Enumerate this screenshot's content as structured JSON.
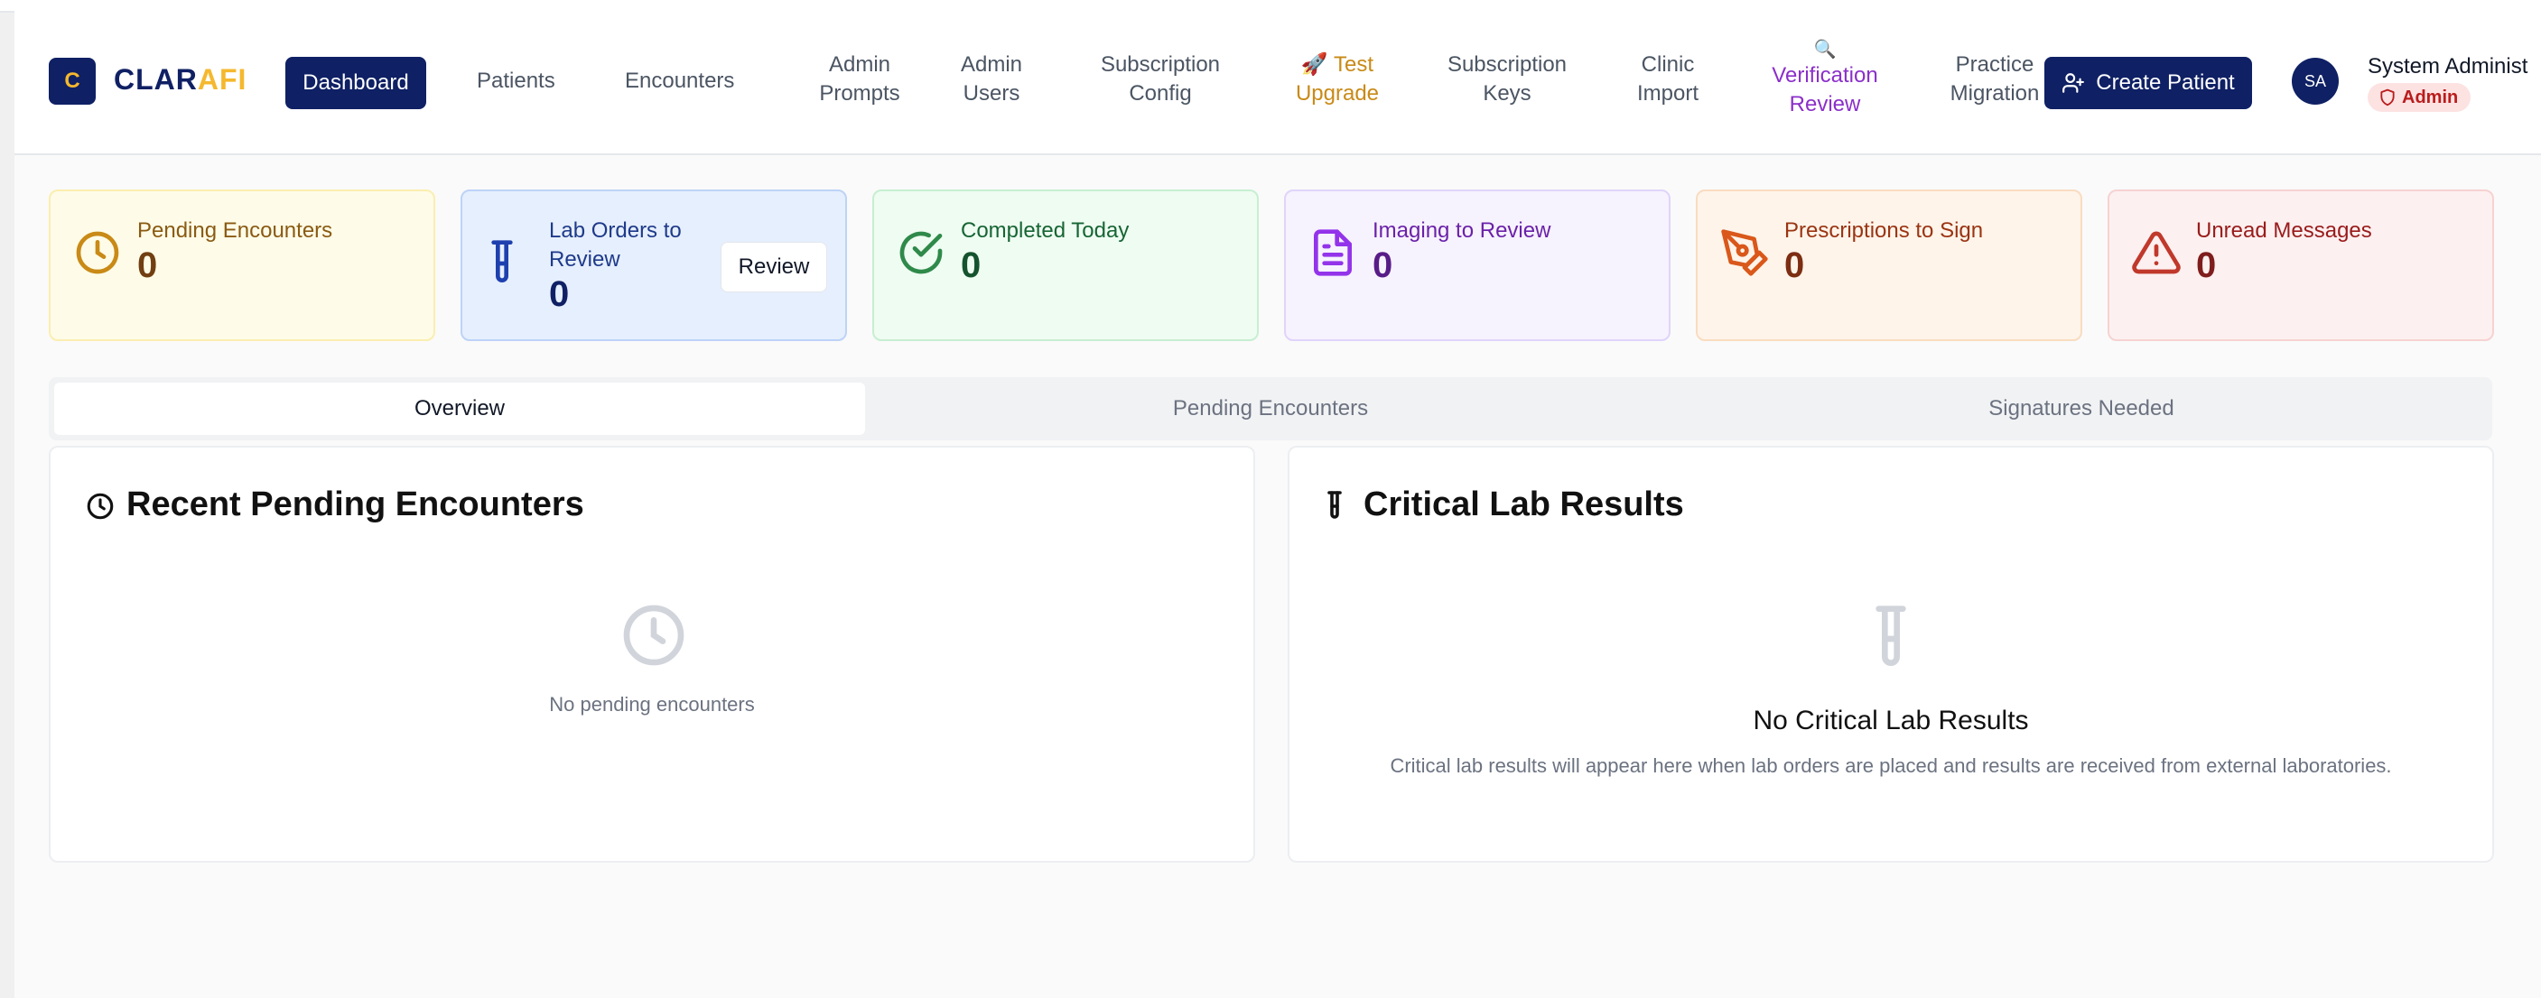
{
  "brand": {
    "logo_letter": "C",
    "name_part1": "CLAR",
    "name_part2": "AFI"
  },
  "nav": {
    "dashboard": "Dashboard",
    "patients": "Patients",
    "encounters": "Encounters",
    "admin_prompts_l1": "Admin",
    "admin_prompts_l2": "Prompts",
    "admin_users_l1": "Admin",
    "admin_users_l2": "Users",
    "sub_config_l1": "Subscription",
    "sub_config_l2": "Config",
    "test_upgrade_l1": "🚀 Test",
    "test_upgrade_l2": "Upgrade",
    "sub_keys_l1": "Subscription",
    "sub_keys_l2": "Keys",
    "clinic_import_l1": "Clinic",
    "clinic_import_l2": "Import",
    "verification_icon": "🔍",
    "verification_l1": "Verification",
    "verification_l2": "Review",
    "practice_l1": "Practice",
    "practice_l2": "Migration"
  },
  "actions": {
    "create_patient": "Create Patient"
  },
  "user": {
    "initials": "SA",
    "name": "System Administ",
    "role": "Admin"
  },
  "stats": {
    "pending": {
      "label": "Pending Encounters",
      "value": "0"
    },
    "lab": {
      "label_l1": "Lab Orders to",
      "label_l2": "Review",
      "value": "0",
      "button": "Review"
    },
    "completed": {
      "label": "Completed Today",
      "value": "0"
    },
    "imaging": {
      "label": "Imaging to Review",
      "value": "0"
    },
    "prescriptions": {
      "label": "Prescriptions to Sign",
      "value": "0"
    },
    "messages": {
      "label": "Unread Messages",
      "value": "0"
    }
  },
  "tabs": {
    "overview": "Overview",
    "pending": "Pending Encounters",
    "signatures": "Signatures Needed"
  },
  "panels": {
    "recent": {
      "title": "Recent Pending Encounters",
      "empty": "No pending encounters"
    },
    "critical": {
      "title": "Critical Lab Results",
      "empty_heading": "No Critical Lab Results",
      "empty_text": "Critical lab results will appear here when lab orders are placed and results are received from external laboratories."
    }
  },
  "colors": {
    "primary": "#0f2064",
    "accent": "#f5b82e"
  }
}
